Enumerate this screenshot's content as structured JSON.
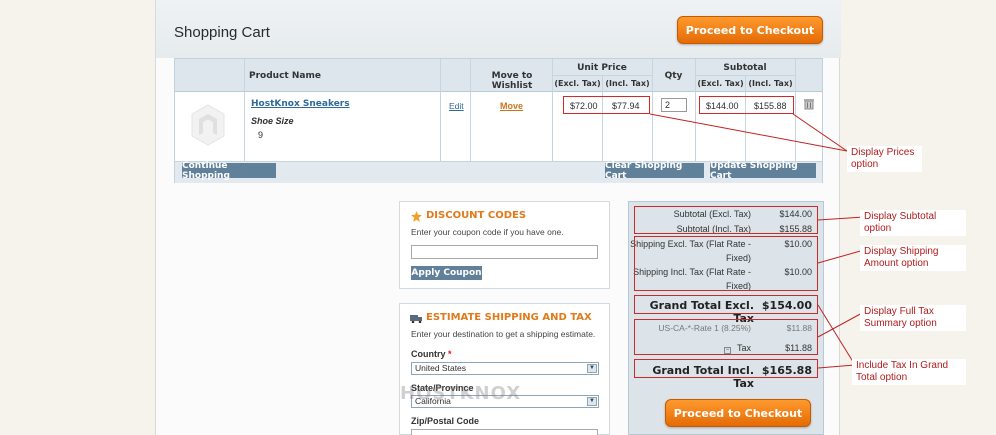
{
  "page": {
    "title": "Shopping Cart"
  },
  "buttons": {
    "checkout_top": "Proceed to Checkout",
    "checkout_bottom": "Proceed to Checkout",
    "continue": "Continue Shopping",
    "clear": "Clear Shopping Cart",
    "update": "Update Shopping Cart",
    "apply_coupon": "Apply Coupon"
  },
  "cart_table": {
    "headers": {
      "product_name": "Product Name",
      "move_to_wishlist": "Move to Wishlist",
      "unit_price": "Unit Price",
      "qty": "Qty",
      "subtotal": "Subtotal",
      "excl_tax": "(Excl. Tax)",
      "incl_tax": "(Incl. Tax)"
    },
    "item": {
      "name": "HostKnox Sneakers",
      "option_label": "Shoe Size",
      "option_value": "9",
      "edit": "Edit",
      "move": "Move",
      "unit_excl": "$72.00",
      "unit_incl": "$77.94",
      "qty": "2",
      "sub_excl": "$144.00",
      "sub_incl": "$155.88"
    }
  },
  "discount": {
    "title": "DISCOUNT CODES",
    "text": "Enter your coupon code if you have one."
  },
  "shipping": {
    "title": "ESTIMATE SHIPPING AND TAX",
    "text": "Enter your destination to get a shipping estimate.",
    "country_label": "Country",
    "country_value": "United States",
    "state_label": "State/Province",
    "state_value": "California",
    "zip_label": "Zip/Postal Code"
  },
  "totals": {
    "subtotal_excl_label": "Subtotal (Excl. Tax)",
    "subtotal_excl": "$144.00",
    "subtotal_incl_label": "Subtotal (Incl. Tax)",
    "subtotal_incl": "$155.88",
    "ship_excl_label_1": "Shipping Excl. Tax (Flat Rate -",
    "ship_excl_label_2": "Fixed)",
    "ship_excl": "$10.00",
    "ship_incl_label_1": "Shipping Incl. Tax (Flat Rate -",
    "ship_incl_label_2": "Fixed)",
    "ship_incl": "$10.00",
    "grand_excl_label": "Grand Total Excl. Tax",
    "grand_excl": "$154.00",
    "tax_rate_label": "US-CA-*-Rate 1 (8.25%)",
    "tax_rate": "$11.88",
    "tax_label": "Tax",
    "tax": "$11.88",
    "grand_incl_label": "Grand Total Incl. Tax",
    "grand_incl": "$165.88"
  },
  "annotations": {
    "prices_1": "Display Prices",
    "prices_2": "option",
    "subtotal_1": "Display Subtotal",
    "subtotal_2": "option",
    "shipping_1": "Display Shipping",
    "shipping_2": "Amount option",
    "fulltax_1": "Display Full Tax",
    "fulltax_2": "Summary option",
    "grand_1": "Include Tax In Grand",
    "grand_2": "Total option"
  },
  "watermark": "HOSTKNOX",
  "colors": {
    "accent": "#e56b06",
    "annotation": "#b01c1c",
    "grey_button": "#61819b"
  }
}
